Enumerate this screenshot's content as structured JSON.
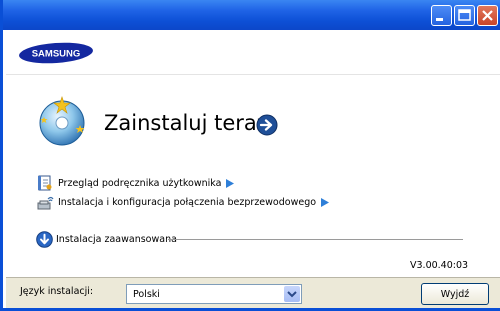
{
  "window": {
    "brand": "SAMSUNG"
  },
  "main": {
    "install_title": "Zainstaluj teraz",
    "links": [
      {
        "label": "Przegląd podręcznika użytkownika",
        "icon": "manual-book-icon"
      },
      {
        "label": "Instalacja i konfiguracja połączenia bezprzewodowego",
        "icon": "wireless-setup-icon"
      }
    ],
    "advanced_label": "Instalacja zaawansowana",
    "version": "V3.00.40:03"
  },
  "footer": {
    "language_label": "Język instalacji:",
    "language_value": "Polski",
    "next_label": "Wyjdź"
  },
  "colors": {
    "titlebar": "#0c47c9",
    "samsung_blue": "#1428a0",
    "accent_arrow": "#2e7fd8"
  }
}
